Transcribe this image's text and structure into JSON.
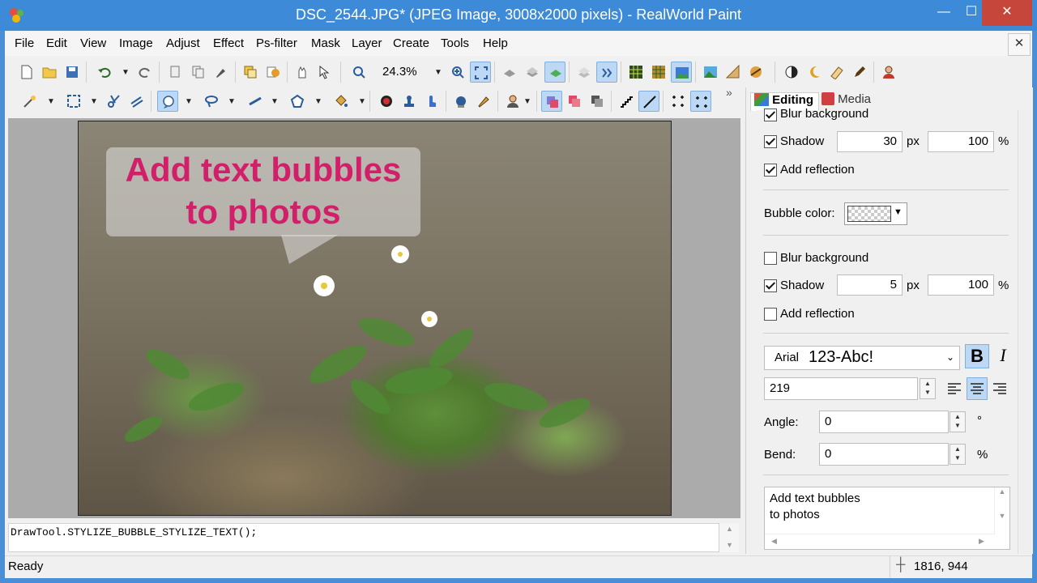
{
  "window": {
    "title": "DSC_2544.JPG* (JPEG Image, 3008x2000 pixels) - RealWorld Paint",
    "minimize": "—",
    "maximize": "☐",
    "close": "✕"
  },
  "menu": [
    "File",
    "Edit",
    "View",
    "Image",
    "Adjust",
    "Effect",
    "Ps-filter",
    "Mask",
    "Layer",
    "Create",
    "Tools",
    "Help"
  ],
  "doc_close": "✕",
  "toolbar": {
    "zoom": "24.3%",
    "more": "»"
  },
  "canvas": {
    "bubble_line1": "Add text bubbles",
    "bubble_line2": "to photos"
  },
  "script": "DrawTool.STYLIZE_BUBBLE_STYLIZE_TEXT();",
  "panel": {
    "tabs": [
      {
        "label": "Editing",
        "active": true
      },
      {
        "label": "Media",
        "active": false
      }
    ],
    "top_blur": "Blur background",
    "shadow1": {
      "label": "Shadow",
      "checked": true,
      "px": "30",
      "px_unit": "px",
      "pct": "100",
      "pct_unit": "%"
    },
    "reflection1": {
      "label": "Add reflection",
      "checked": true
    },
    "bubble_color_label": "Bubble color:",
    "blur2": {
      "label": "Blur background",
      "checked": false
    },
    "shadow2": {
      "label": "Shadow",
      "checked": true,
      "px": "5",
      "px_unit": "px",
      "pct": "100",
      "pct_unit": "%"
    },
    "reflection2": {
      "label": "Add reflection",
      "checked": false
    },
    "font": {
      "name": "Arial",
      "sample": "123-Abc!",
      "size": "219",
      "bold": "B",
      "italic": "I"
    },
    "angle": {
      "label": "Angle:",
      "value": "0",
      "unit": "°"
    },
    "bend": {
      "label": "Bend:",
      "value": "0",
      "unit": "%"
    },
    "text_line1": "Add text bubbles",
    "text_line2": "to photos"
  },
  "status": {
    "text": "Ready",
    "coords": "1816, 944"
  },
  "colors": {
    "title_bar": "#3c8ad8",
    "bubble_text": "#d21f6a",
    "close": "#c7463b"
  }
}
